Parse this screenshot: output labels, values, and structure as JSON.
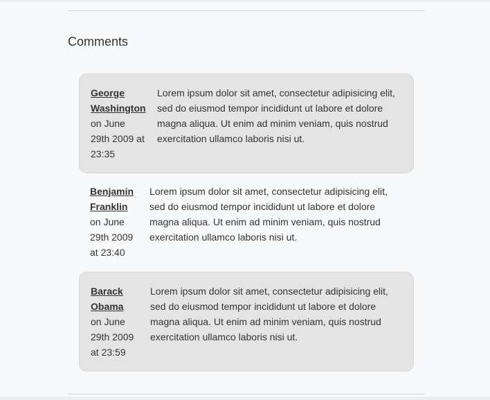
{
  "comments_section": {
    "heading": "Comments",
    "comments": [
      {
        "author": "George Washington",
        "date": "on June 29th 2009 at 23:35",
        "text": "Lorem ipsum dolor sit amet, consectetur adipisicing elit, sed do eiusmod tempor incididunt ut labore et dolore magna aliqua. Ut enim ad minim veniam, quis nostrud exercitation ullamco laboris nisi ut."
      },
      {
        "author": "Benjamin Franklin",
        "date": "on June 29th 2009 at 23:40",
        "text": "Lorem ipsum dolor sit amet, consectetur adipisicing elit, sed do eiusmod tempor incididunt ut labore et dolore magna aliqua. Ut enim ad minim veniam, quis nostrud exercitation ullamco laboris nisi ut."
      },
      {
        "author": "Barack Obama",
        "date": "on June 29th 2009 at 23:59",
        "text": "Lorem ipsum dolor sit amet, consectetur adipisicing elit, sed do eiusmod tempor incididunt ut labore et dolore magna aliqua. Ut enim ad minim veniam, quis nostrud exercitation ullamco laboris nisi ut."
      }
    ]
  }
}
